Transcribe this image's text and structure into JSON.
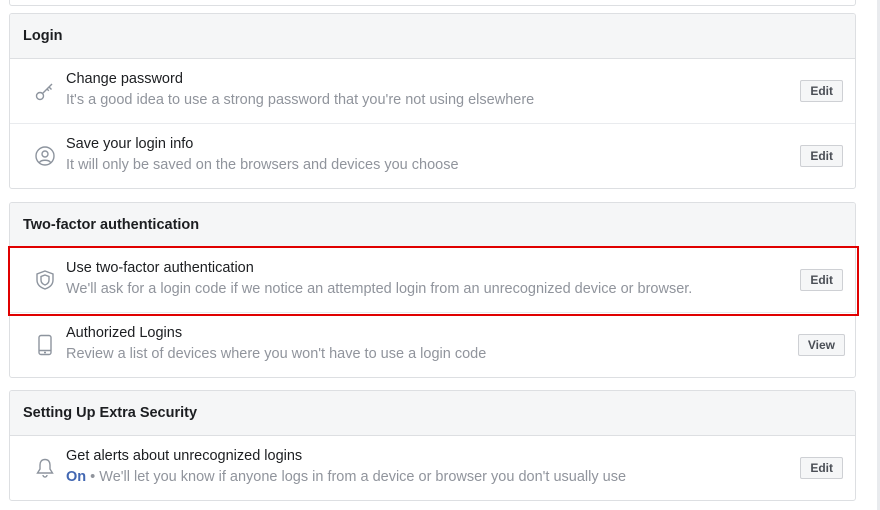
{
  "sections": {
    "login": {
      "header": "Login",
      "rows": [
        {
          "title": "Change password",
          "desc": "It's a good idea to use a strong password that you're not using elsewhere",
          "button": "Edit",
          "icon": "key-icon"
        },
        {
          "title": "Save your login info",
          "desc": "It will only be saved on the browsers and devices you choose",
          "button": "Edit",
          "icon": "user-circle-icon"
        }
      ]
    },
    "two_factor": {
      "header": "Two-factor authentication",
      "rows": [
        {
          "title": "Use two-factor authentication",
          "desc": "We'll ask for a login code if we notice an attempted login from an unrecognized device or browser.",
          "button": "Edit",
          "icon": "shield-icon"
        },
        {
          "title": "Authorized Logins",
          "desc": "Review a list of devices where you won't have to use a login code",
          "button": "View",
          "icon": "phone-icon"
        }
      ]
    },
    "extra_security": {
      "header": "Setting Up Extra Security",
      "rows": [
        {
          "title": "Get alerts about unrecognized logins",
          "status": "On",
          "desc": " • We'll let you know if anyone logs in from a device or browser you don't usually use",
          "button": "Edit",
          "icon": "bell-icon"
        }
      ]
    }
  },
  "colors": {
    "highlight": "#e00000",
    "accent": "#4267b2"
  }
}
